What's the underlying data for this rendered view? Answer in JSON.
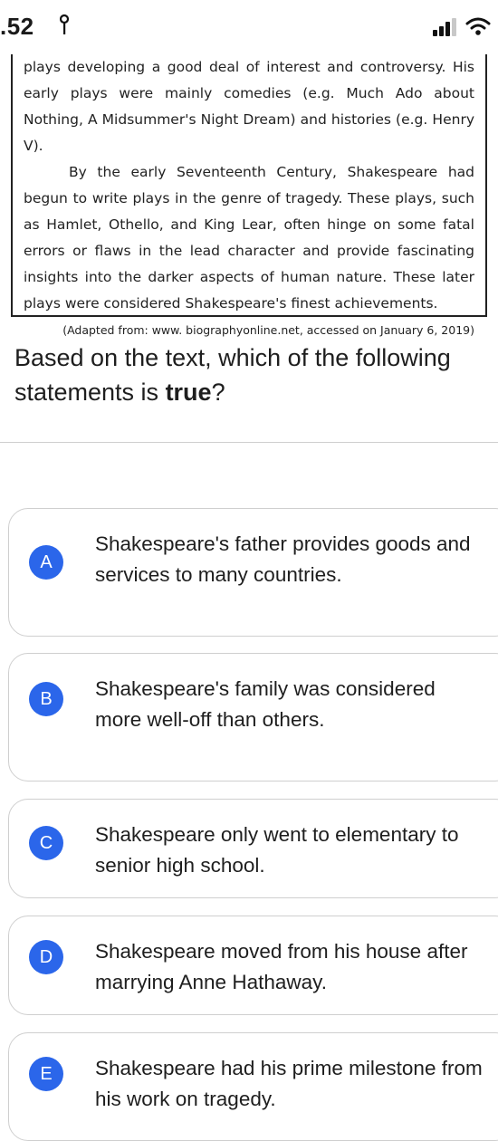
{
  "status_bar": {
    "time": ".52",
    "icons": [
      "location-icon",
      "signal-icon",
      "wifi-icon"
    ]
  },
  "passage": {
    "paragraph1": "plays developing a good deal of interest and controversy. His early plays were mainly comedies (e.g. Much Ado about Nothing, A Midsummer's Night Dream) and histories (e.g. Henry V).",
    "paragraph2": "By the early Seventeenth Century, Shakespeare had begun to write plays in the genre of tragedy. These plays, such as Hamlet, Othello, and King Lear, often hinge on some fatal errors or flaws in the lead character and provide fascinating insights into the darker aspects of human nature. These later plays were considered Shakespeare's finest achievements.",
    "source": "(Adapted from: www. biographyonline.net, accessed on January 6, 2019)"
  },
  "question": {
    "prefix": "Based on the text, which of the following statements is ",
    "emphasis": "true",
    "suffix": "?"
  },
  "options": [
    {
      "letter": "A",
      "text": "Shakespeare's father provides goods and services to many countries."
    },
    {
      "letter": "B",
      "text": "Shakespeare's family was considered more well-off than others."
    },
    {
      "letter": "C",
      "text": "Shakespeare only went to elementary to senior high school."
    },
    {
      "letter": "D",
      "text": "Shakespeare moved from his house after marrying Anne Hathaway."
    },
    {
      "letter": "E",
      "text": "Shakespeare had his prime milestone from his work on tragedy."
    }
  ],
  "colors": {
    "accent": "#2b66ea",
    "card_border": "#cfcfcf",
    "text": "#1e1e1e"
  }
}
